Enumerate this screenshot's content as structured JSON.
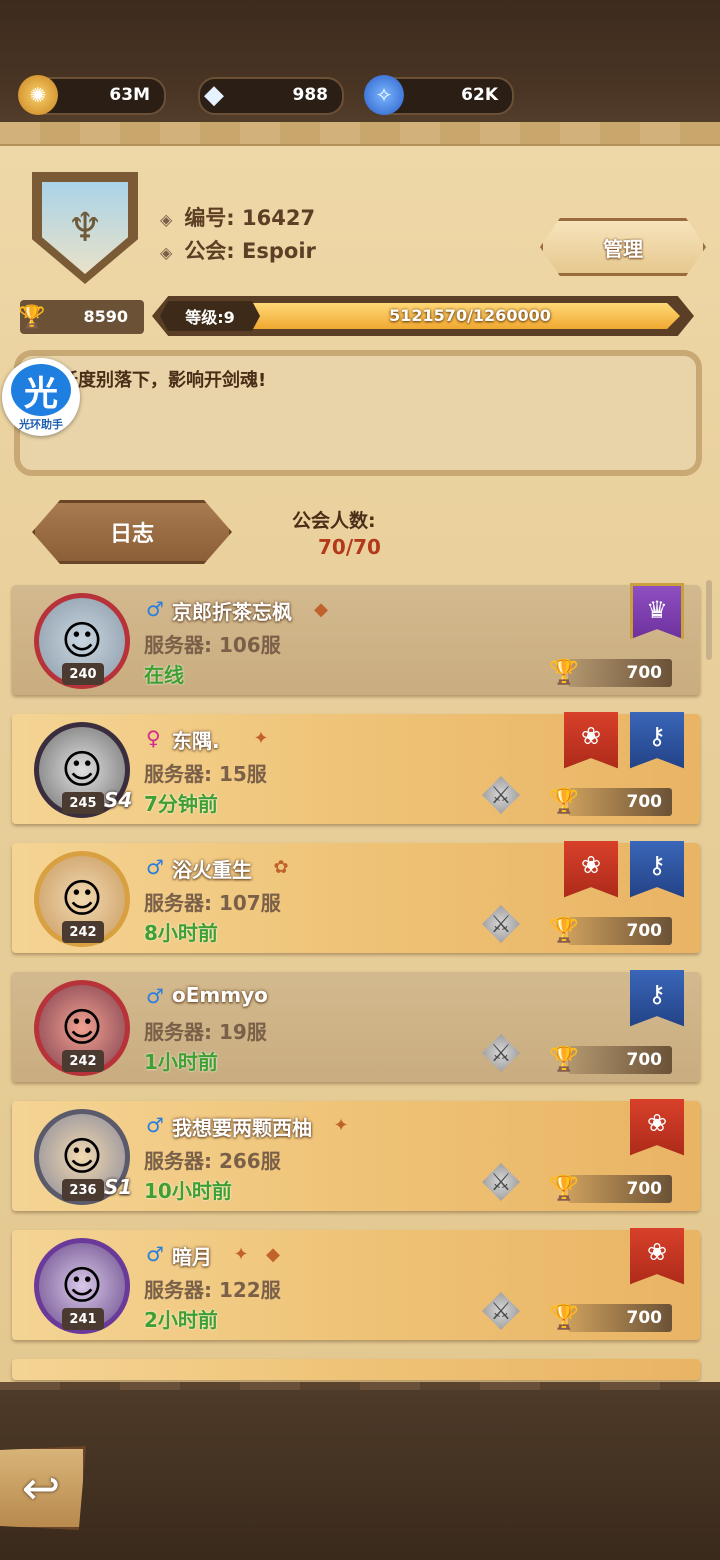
{
  "resources": [
    {
      "name": "gold",
      "value": "63M",
      "icon": "gold-coin-icon",
      "color": "#e9a940"
    },
    {
      "name": "diamond",
      "value": "988",
      "icon": "diamond-icon",
      "color": "#cfe4f7"
    },
    {
      "name": "dust",
      "value": "62K",
      "icon": "blue-dust-icon",
      "color": "#3a7ad8"
    }
  ],
  "guild": {
    "id_label": "编号: 16427",
    "name_label": "公会: Espoir",
    "manage_label": "管理",
    "trophies": "8590",
    "level_label": "等级:9",
    "level_progress": "5121570/1260000",
    "level_progress_fraction": 1.0,
    "notice": "活跃度别落下，影响开剑魂!",
    "notice_visible": "跃度别落下，影响开剑魂!",
    "log_label": "日志",
    "member_count_label": "公会人数:",
    "member_count": "70/70"
  },
  "helper_badge": {
    "char": "光",
    "label": "光环助手"
  },
  "members": [
    {
      "name": "京郎折茶忘枫",
      "gender": "♂",
      "server": "服务器: 106服",
      "status": "在线",
      "level": "240",
      "season": "",
      "score": "700",
      "style": "gray",
      "banners": [
        "purple"
      ],
      "swords": false,
      "badges": [
        "◆"
      ]
    },
    {
      "name": "东隅.",
      "gender": "♀",
      "server": "服务器: 15服",
      "status": "7分钟前",
      "level": "245",
      "season": "S4",
      "score": "700",
      "style": "gold",
      "banners": [
        "red",
        "blue"
      ],
      "swords": true,
      "badges": [
        "✦"
      ]
    },
    {
      "name": "浴火重生",
      "gender": "♂",
      "server": "服务器: 107服",
      "status": "8小时前",
      "level": "242",
      "season": "",
      "score": "700",
      "style": "gold",
      "banners": [
        "red",
        "blue"
      ],
      "swords": true,
      "badges": [
        "✿"
      ]
    },
    {
      "name": "oEmmyo",
      "gender": "♂",
      "server": "服务器: 19服",
      "status": "1小时前",
      "level": "242",
      "season": "",
      "score": "700",
      "style": "gray",
      "banners": [
        "blue"
      ],
      "swords": true,
      "badges": []
    },
    {
      "name": "我想要两颗西柚",
      "gender": "♂",
      "server": "服务器: 266服",
      "status": "10小时前",
      "level": "236",
      "season": "S1",
      "score": "700",
      "style": "gold",
      "banners": [
        "red"
      ],
      "swords": true,
      "badges": [
        "✦"
      ]
    },
    {
      "name": "暗月",
      "gender": "♂",
      "server": "服务器: 122服",
      "status": "2小时前",
      "level": "241",
      "season": "",
      "score": "700",
      "style": "gold",
      "banners": [
        "red"
      ],
      "swords": true,
      "badges": [
        "✦",
        "◆"
      ]
    }
  ],
  "back_label": "↩"
}
